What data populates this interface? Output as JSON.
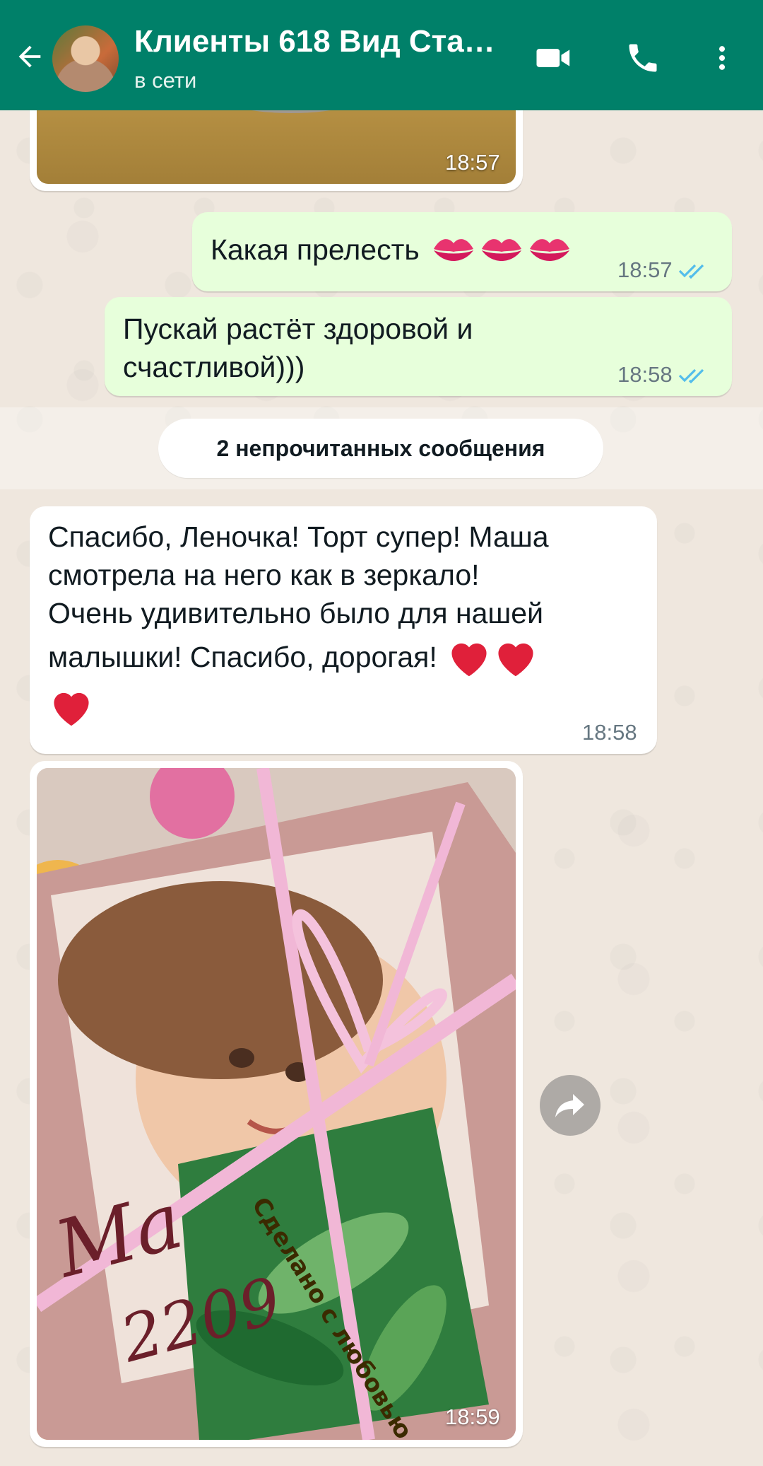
{
  "header": {
    "title": "Клиенты 618 Вид Ста…",
    "status": "в сети"
  },
  "messages": {
    "top_media_time": "18:57",
    "out1": {
      "text": "Какая прелесть",
      "time": "18:57"
    },
    "out2": {
      "line1": "Пускай растёт здоровой и",
      "line2": "счастливой)))",
      "time": "18:58"
    },
    "unread": "2 непрочитанных сообщения",
    "in1": {
      "line1": "Спасибо, Леночка! Торт супер! Маша",
      "line2": "смотрела на него как в зеркало!",
      "line3": "Очень удивительно было для нашей",
      "line4": "малышки! Спасибо, дорогая!",
      "time": "18:58"
    },
    "photo": {
      "cake_text": "Сделано с любовью",
      "time": "18:59"
    }
  },
  "colors": {
    "header": "#008069",
    "outgoing": "#e7ffdb",
    "incoming": "#ffffff",
    "read_ticks": "#53bdeb"
  }
}
